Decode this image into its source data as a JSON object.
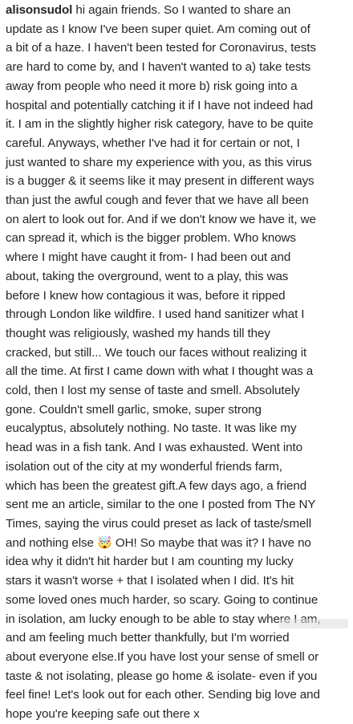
{
  "post": {
    "username": "alisonsudol",
    "lines": [
      " hi again friends. So I wanted to share an",
      "update as I know I've been super quiet. Am coming out of",
      "a bit of a haze. I haven't been tested for Coronavirus, tests",
      "are hard to come by, and I haven't wanted to a) take tests",
      "away from people who need it more b) risk going into a",
      "hospital and potentially catching it if I have not indeed had",
      "it. I am in the slightly higher risk category, have to be quite",
      "careful. Anyways, whether I've had it for certain or not, I",
      "just wanted to share my experience with you, as this virus",
      "is a bugger & it seems like it may present in different ways",
      "than just the awful cough and fever that we have all been",
      "on alert to look out for. And if we don't know we have it, we",
      "can spread it, which is the bigger problem. Who knows",
      "where I might have caught it from- I had been out and",
      "about, taking the overground, went to a play, this was",
      "before I knew how contagious it was, before it ripped",
      "through London like wildfire. I used hand sanitizer what I",
      "thought was religiously, washed my hands till they",
      "cracked, but still... We touch our faces without realizing it",
      "all the time. At first I came down with what I thought was a",
      "cold, then I lost my sense of taste and smell. Absolutely",
      "gone. Couldn't smell garlic, smoke, super strong",
      "eucalyptus, absolutely nothing. No taste. It was like my",
      "head was in a fish tank. And I was exhausted. Went into",
      "isolation out of the city at my wonderful friends farm,",
      "which has been the greatest gift.A few days ago, a friend",
      "sent me an article, similar to the one I posted from The NY",
      "Times, saying the virus could preset as lack of taste/smell",
      "and nothing else 🤯 OH! So maybe that was it? I have no",
      "idea why it didn't hit harder but I am counting my lucky",
      "stars it wasn't worse + that I isolated when I did. It's hit",
      "some loved ones much harder, so scary. Going to continue",
      "in isolation, am lucky enough to be able to stay where I am,",
      "and am feeling much better thankfully, but I'm worried",
      "about everyone else.If you have lost your sense of smell or",
      "taste & not isolating, please go home & isolate- even if you",
      "feel fine! Let's look out for each other. Sending big love and",
      "hope you're keeping safe out there x"
    ]
  }
}
